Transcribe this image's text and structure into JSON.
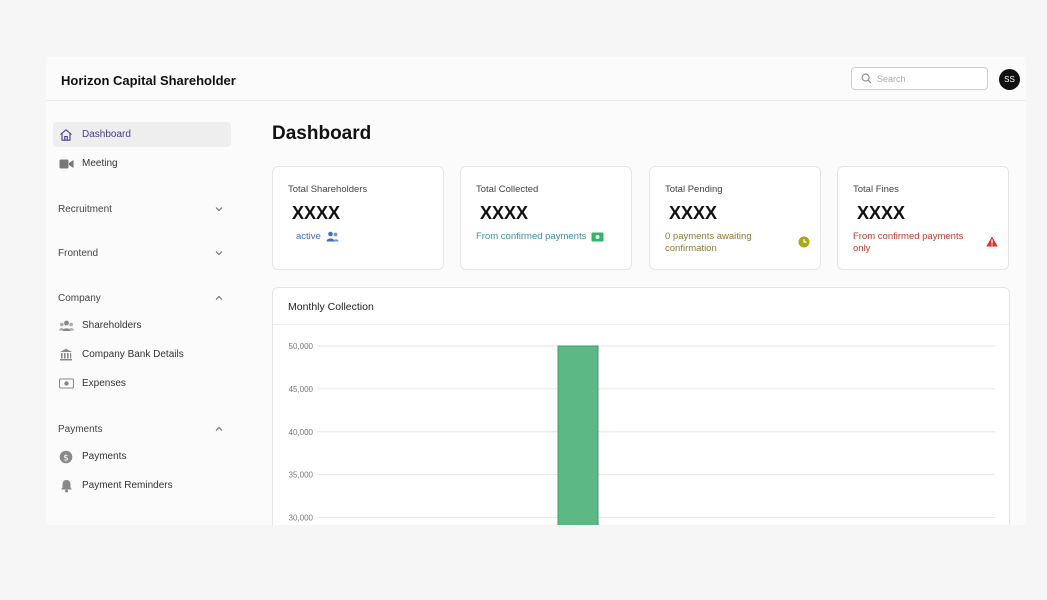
{
  "header": {
    "brand": "Horizon Capital Shareholder",
    "search_placeholder": "Search",
    "avatar_initials": "SS"
  },
  "sidebar": {
    "items": [
      {
        "label": "Dashboard",
        "icon": "home-icon",
        "active": true
      },
      {
        "label": "Meeting",
        "icon": "video-icon"
      }
    ],
    "sections": [
      {
        "label": "Recruitment",
        "expanded": false,
        "items": []
      },
      {
        "label": "Frontend",
        "expanded": false,
        "items": []
      },
      {
        "label": "Company",
        "expanded": true,
        "items": [
          {
            "label": "Shareholders",
            "icon": "users-icon"
          },
          {
            "label": "Company Bank Details",
            "icon": "bank-icon"
          },
          {
            "label": "Expenses",
            "icon": "money-icon"
          }
        ]
      },
      {
        "label": "Payments",
        "expanded": true,
        "items": [
          {
            "label": "Payments",
            "icon": "dollar-icon"
          },
          {
            "label": "Payment Reminders",
            "icon": "bell-icon"
          }
        ]
      }
    ]
  },
  "main": {
    "title": "Dashboard",
    "cards": [
      {
        "title": "Total Shareholders",
        "value": "XXXX",
        "sub": "active",
        "sub_color": "#3d6fc4"
      },
      {
        "title": "Total Collected",
        "value": "XXXX",
        "sub": "From confirmed payments",
        "sub_color": "#3a8fa0"
      },
      {
        "title": "Total Pending",
        "value": "XXXX",
        "sub": "0 payments awaiting confirmation",
        "sub_color": "#8a7a3a"
      },
      {
        "title": "Total Fines",
        "value": "XXXX",
        "sub": "From confirmed payments only",
        "sub_color": "#c0392b"
      }
    ]
  },
  "chart_data": {
    "type": "bar",
    "title": "Monthly Collection",
    "ylim": [
      30000,
      50000
    ],
    "y_ticks": [
      "50,000",
      "45,000",
      "40,000",
      "35,000",
      "30,000"
    ],
    "series": [
      {
        "values": [
          50000
        ]
      }
    ],
    "bar_color": "#5cb885",
    "grid": true
  }
}
